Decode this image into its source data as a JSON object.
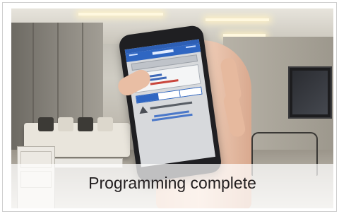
{
  "caption": {
    "text": "Programming complete"
  },
  "colors": {
    "caption_text": "#231f20",
    "caption_band": "#ffffff",
    "app_header_blue": "#2f66c2"
  },
  "scene": {
    "icons": [
      "phone-icon",
      "warning-icon"
    ]
  }
}
